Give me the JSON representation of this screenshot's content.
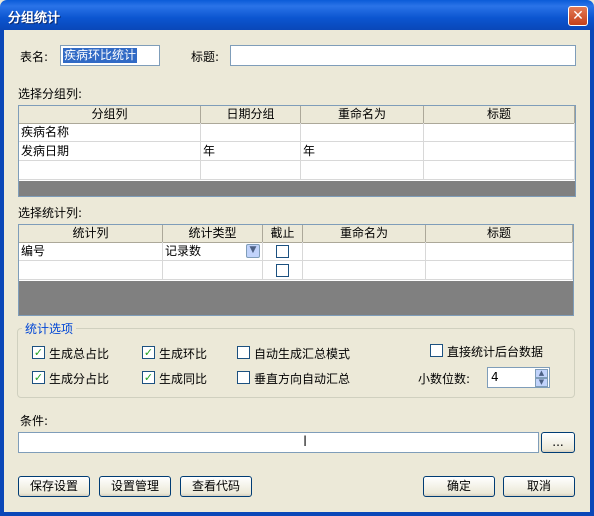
{
  "window": {
    "title": "分组统计",
    "close_label": "✕"
  },
  "form": {
    "table_name_label": "表名:",
    "table_name_value": "疾病环比统计",
    "heading_label": "标题:",
    "heading_value": ""
  },
  "group_section": {
    "label": "选择分组列:",
    "headers": [
      "分组列",
      "日期分组",
      "重命名为",
      "标题"
    ],
    "rows": [
      [
        "疾病名称",
        "",
        "",
        ""
      ],
      [
        "发病日期",
        "年",
        "年",
        ""
      ],
      [
        "",
        "",
        "",
        ""
      ]
    ]
  },
  "stat_section": {
    "label": "选择统计列:",
    "headers": [
      "统计列",
      "统计类型",
      "截止",
      "重命名为",
      "标题"
    ],
    "rows": [
      {
        "column": "编号",
        "type": "记录数",
        "cutoff": false,
        "rename": "",
        "title": ""
      },
      {
        "column": "",
        "type": "",
        "cutoff": false,
        "rename": "",
        "title": ""
      }
    ]
  },
  "options": {
    "group_title": "统计选项",
    "items": [
      {
        "label": "生成总占比",
        "checked": true
      },
      {
        "label": "生成环比",
        "checked": true
      },
      {
        "label": "自动生成汇总模式",
        "checked": false
      },
      {
        "label": "直接统计后台数据",
        "checked": false
      },
      {
        "label": "生成分占比",
        "checked": true
      },
      {
        "label": "生成同比",
        "checked": true
      },
      {
        "label": "垂直方向自动汇总",
        "checked": false
      }
    ],
    "decimal_label": "小数位数:",
    "decimal_value": "4"
  },
  "condition": {
    "label": "条件:",
    "value": "",
    "browse_label": "..."
  },
  "buttons": {
    "save_settings": "保存设置",
    "manage_settings": "设置管理",
    "view_code": "查看代码",
    "ok": "确定",
    "cancel": "取消"
  }
}
